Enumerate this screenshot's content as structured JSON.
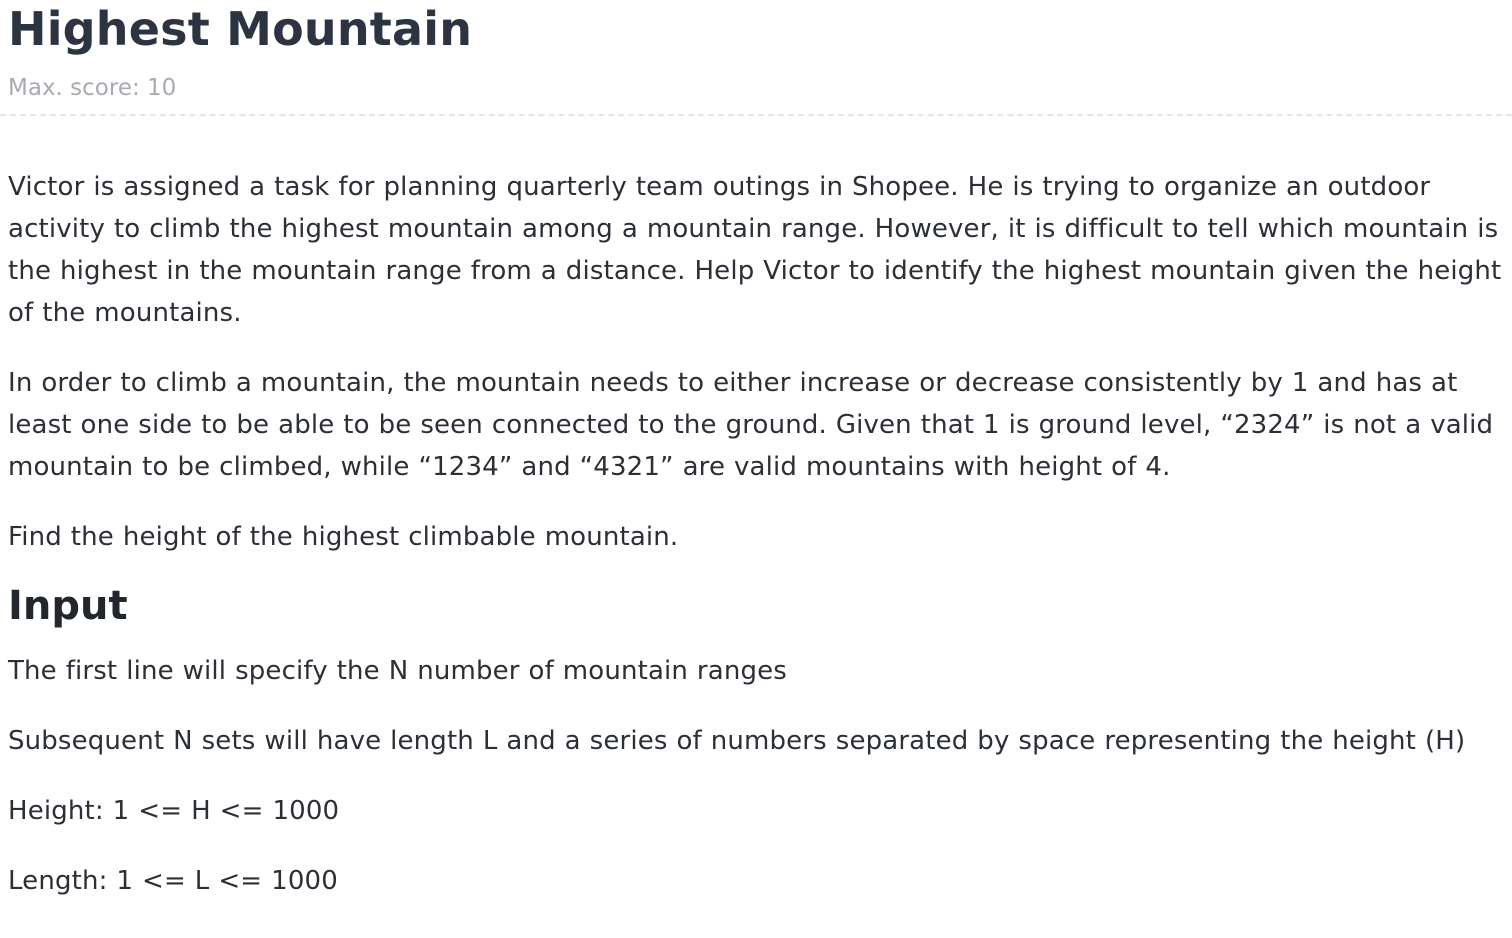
{
  "problem": {
    "title": "Highest Mountain",
    "max_score": "Max. score: 10"
  },
  "statement": {
    "paragraph_1": "Victor is assigned a task for planning quarterly team outings in Shopee. He is trying to organize an outdoor activity to climb the highest mountain among a mountain range. However, it is difficult to tell which mountain is the highest in the mountain range from a distance. Help Victor to identify the highest mountain given the height of the mountains.",
    "paragraph_2": "In order to climb a mountain, the mountain needs to either increase or decrease consistently by 1 and has at least one side to be able to be seen connected to the ground. Given that 1 is ground level, “2324” is not a valid mountain to be climbed, while “1234” and “4321” are valid mountains with height of 4.",
    "paragraph_3": "Find the height of the highest climbable mountain."
  },
  "input_section": {
    "heading": "Input",
    "line_1": "The first line will specify the N number of mountain ranges",
    "line_2": "Subsequent N sets will have length L and a series of numbers separated by space representing the height (H)",
    "line_3": "Height: 1 <= H <= 1000",
    "line_4": "Length: 1 <= L <= 1000"
  }
}
